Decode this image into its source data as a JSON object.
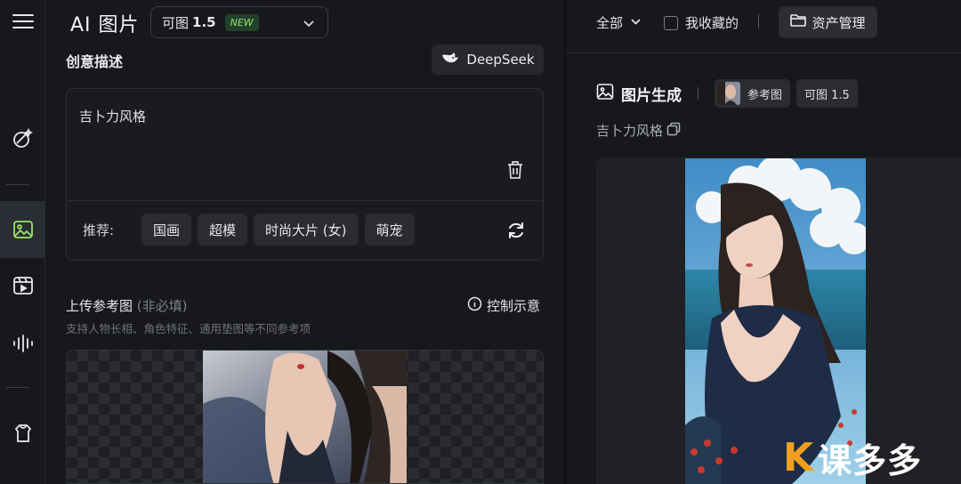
{
  "header": {
    "app_title": "AI 图片",
    "model_name": "可图",
    "model_version": "1.5",
    "model_badge": "NEW"
  },
  "creative": {
    "title": "创意描述",
    "deepseek_label": "DeepSeek",
    "prompt_value": "吉卜力风格",
    "recommend_label": "推荐:",
    "chips": [
      "国画",
      "超模",
      "时尚大片 (女)",
      "萌宠"
    ]
  },
  "upload": {
    "title": "上传参考图",
    "optional": "(非必填)",
    "control_label": "控制示意",
    "hint": "支持人物长相、角色特征、通用垫图等不同参考项"
  },
  "topbar": {
    "filter_all": "全部",
    "favorites": "我收藏的",
    "assets": "资产管理"
  },
  "generation": {
    "title": "图片生成",
    "ref_tag": "参考图",
    "model_tag": "可图 1.5",
    "prompt": "吉卜力风格"
  },
  "watermark": {
    "text": "课多多"
  }
}
